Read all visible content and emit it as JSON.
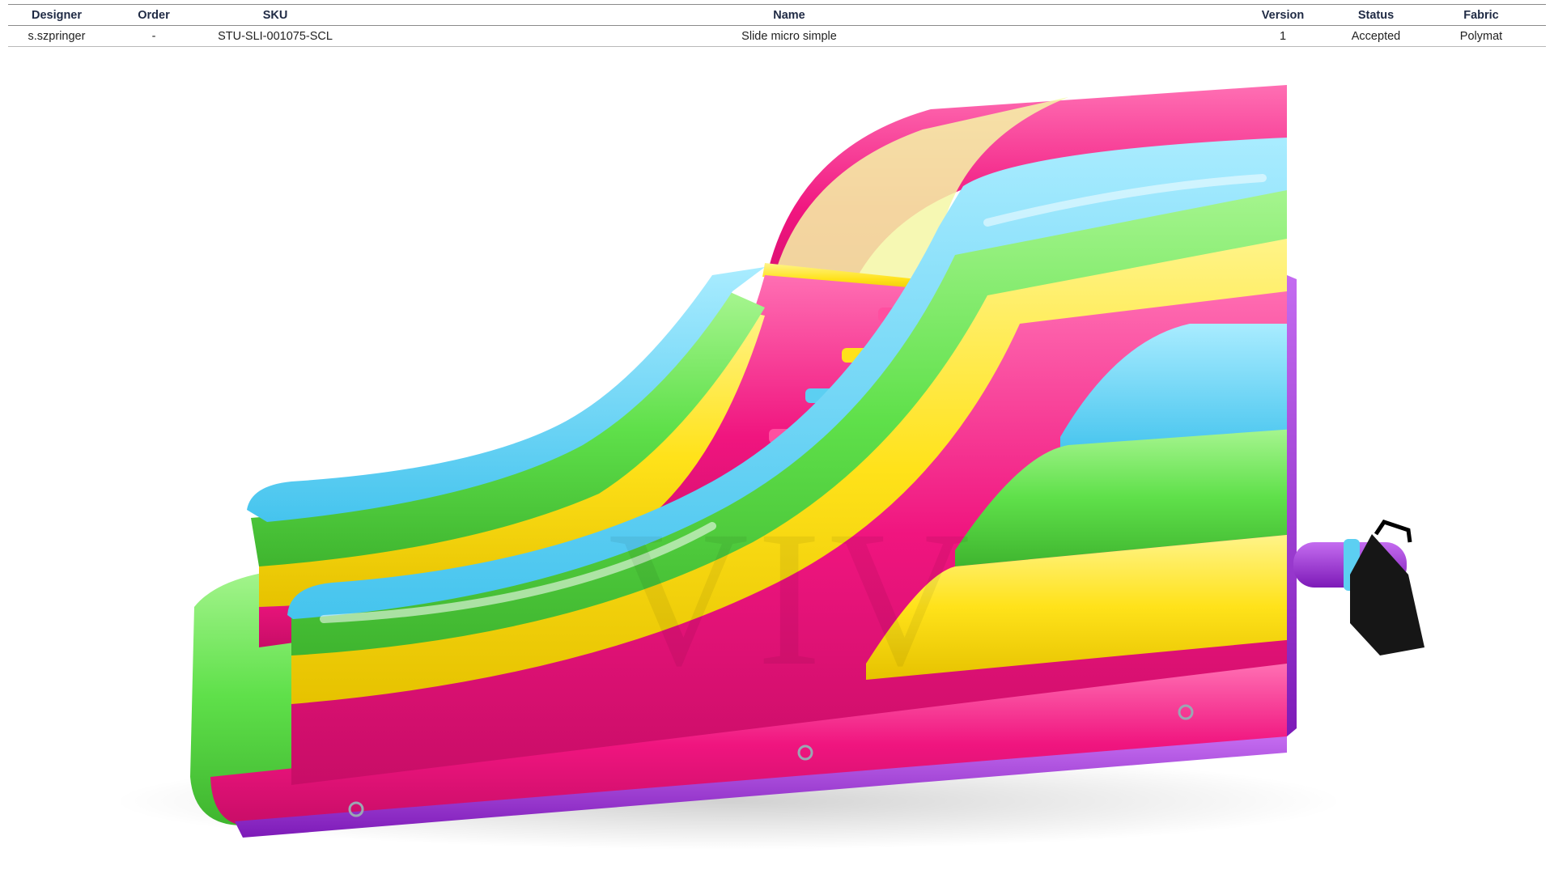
{
  "record": {
    "headers": [
      "Designer",
      "Order",
      "SKU",
      "Name",
      "Version",
      "Status",
      "Fabric"
    ],
    "row": [
      "s.szpringer",
      "-",
      "STU-SLI-001075-SCL",
      "Slide micro simple",
      "1",
      "Accepted",
      "Polymat"
    ]
  },
  "watermark": "VIV",
  "colors": {
    "pink": "#f0157f",
    "green": "#5fe04a",
    "yellow": "#ffe21a",
    "blue": "#5ccff2",
    "purple": "#9a2bd8",
    "blower": "#161616"
  }
}
